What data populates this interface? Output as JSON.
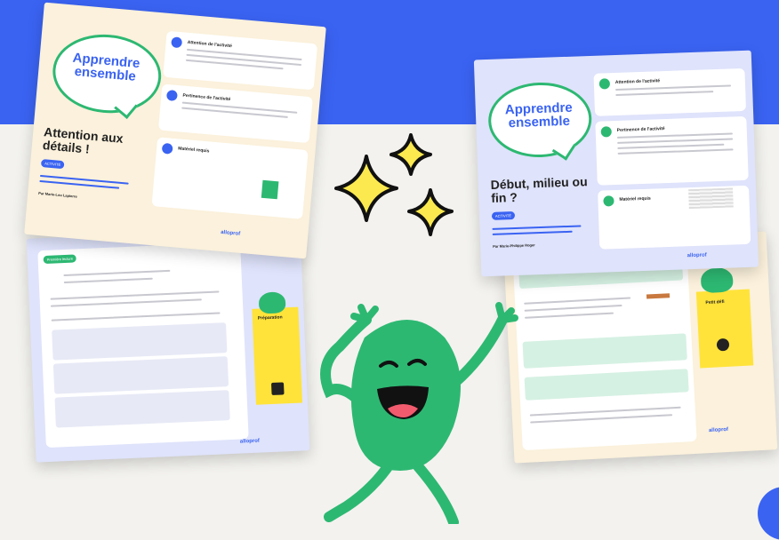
{
  "colors": {
    "band": "#3a63f2",
    "background": "#f3f2ee",
    "mascot": "#2db872",
    "sparkle": "#fbe94f"
  },
  "sheet1": {
    "brand": "Apprendre ensemble",
    "title": "Attention aux détails !",
    "tag": "ACTIVITÉ",
    "sections": [
      "Attention de l'activité",
      "Pertinence de l'activité",
      "Matériel requis"
    ],
    "author": "Par Marie-Lou Lapierre",
    "logo": "alloprof"
  },
  "sheet2": {
    "banner": "Première lecture",
    "aside_title": "Préparation",
    "logo": "alloprof"
  },
  "sheet3": {
    "brand": "Apprendre ensemble",
    "title": "Début, milieu ou fin ?",
    "tag": "ACTIVITÉ",
    "sections": [
      "Attention de l'activité",
      "Pertinence de l'activité",
      "Matériel requis"
    ],
    "author": "Par Marie-Philippe Roger",
    "logo": "alloprof"
  },
  "sheet4": {
    "aside_title": "Petit défi",
    "logo": "alloprof"
  },
  "icons": [
    "sparkle-icon",
    "mascot-character",
    "lightbulb-icon",
    "book-icon",
    "box-icon",
    "magnifier-icon"
  ]
}
